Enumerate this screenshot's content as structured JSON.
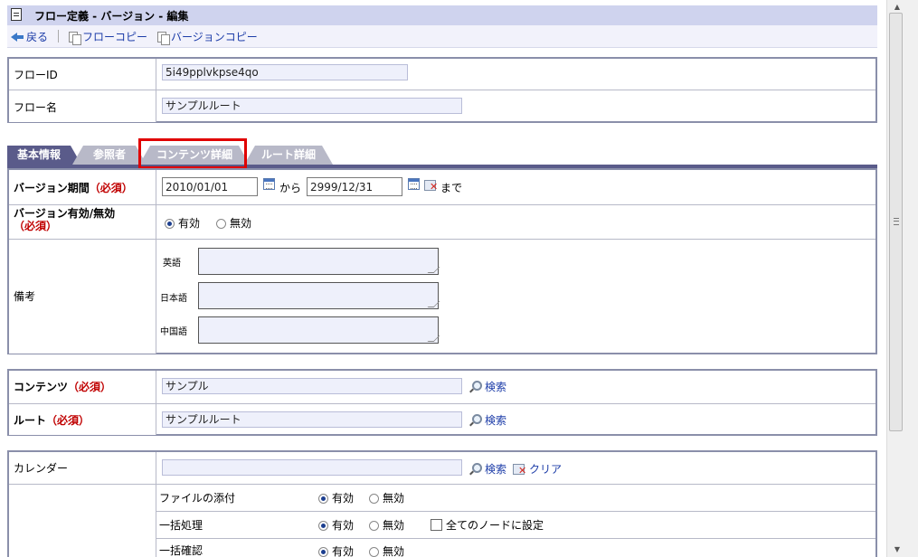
{
  "header": {
    "title": "フロー定義 - バージョン - 編集"
  },
  "toolbar": {
    "back": "戻る",
    "flow_copy": "フローコピー",
    "version_copy": "バージョンコピー"
  },
  "flow": {
    "id_label": "フローID",
    "id_value": "5i49pplvkpse4qo",
    "name_label": "フロー名",
    "name_value": "サンプルルート"
  },
  "tabs": [
    "基本情報",
    "参照者",
    "コンテンツ詳細",
    "ルート詳細"
  ],
  "version": {
    "period_label": "バージョン期間",
    "required": "（必須）",
    "from_date": "2010/01/01",
    "from_text": "から",
    "to_date": "2999/12/31",
    "until_text": "まで",
    "enable_label": "バージョン有効/無効",
    "enabled": "有効",
    "disabled": "無効"
  },
  "remarks": {
    "label": "備考",
    "lang_en": "英語",
    "lang_ja": "日本語",
    "lang_zh": "中国語"
  },
  "content": {
    "content_label": "コンテンツ",
    "required": "（必須）",
    "content_value": "サンプル",
    "route_label": "ルート",
    "route_value": "サンプルルート",
    "search": "検索"
  },
  "calendar": {
    "label": "カレンダー",
    "value": "",
    "search": "検索",
    "clear": "クリア",
    "settings": [
      {
        "label": "ファイルの添付",
        "on": "有効",
        "off": "無効"
      },
      {
        "label": "一括処理",
        "on": "有効",
        "off": "無効",
        "extra": "全てのノードに設定"
      },
      {
        "label": "一括確認",
        "on": "有効",
        "off": "無効"
      }
    ]
  }
}
